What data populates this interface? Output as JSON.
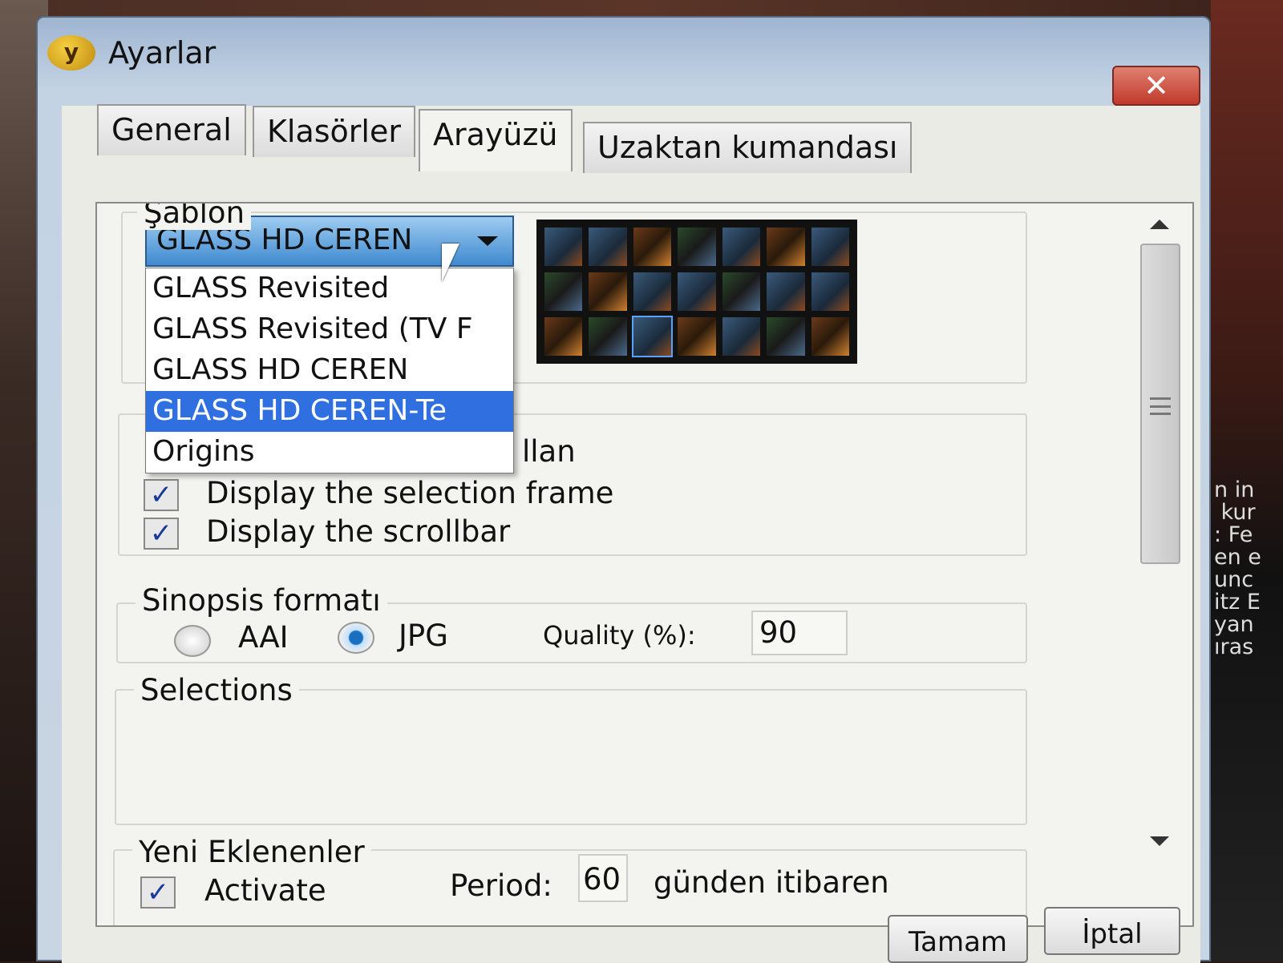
{
  "window": {
    "title": "Ayarlar",
    "logo_text": "y"
  },
  "tabs": [
    {
      "label": "General"
    },
    {
      "label": "Klasörler"
    },
    {
      "label": "Arayüzü"
    },
    {
      "label": "Uzaktan kumandası"
    }
  ],
  "active_tab": "Arayüzü",
  "template": {
    "group_label": "Şablon",
    "selected": "GLASS HD CEREN",
    "options": [
      "GLASS Revisited",
      "GLASS Revisited (TV F",
      "GLASS HD CEREN",
      "GLASS HD CEREN-Te",
      "Origins"
    ],
    "highlighted_option": "GLASS HD CEREN-Te"
  },
  "display": {
    "hidden_option_text": "llan",
    "selection_frame": {
      "label": "Display the selection frame",
      "checked": true
    },
    "scrollbar": {
      "label": "Display the scrollbar",
      "checked": true
    }
  },
  "synopsis": {
    "group_label": "Sinopsis formatı",
    "aai_label": "AAI",
    "jpg_label": "JPG",
    "selected": "JPG",
    "quality_label": "Quality (%):",
    "quality_value": "90"
  },
  "selections": {
    "group_label": "Selections"
  },
  "new_additions": {
    "group_label": "Yeni Eklenenler",
    "activate_label": "Activate",
    "activate_checked": true,
    "period_label": "Period:",
    "period_value": "60",
    "period_suffix": "günden itibaren"
  },
  "buttons": {
    "ok": "Tamam",
    "cancel": "İptal"
  },
  "background_text": "n in\n kur\n: Fe\nen e\nunc\nitz E\nyan\nıras",
  "colors": {
    "highlight": "#2f6fe0",
    "combo": "#3e8ad0",
    "close": "#c0392b"
  }
}
